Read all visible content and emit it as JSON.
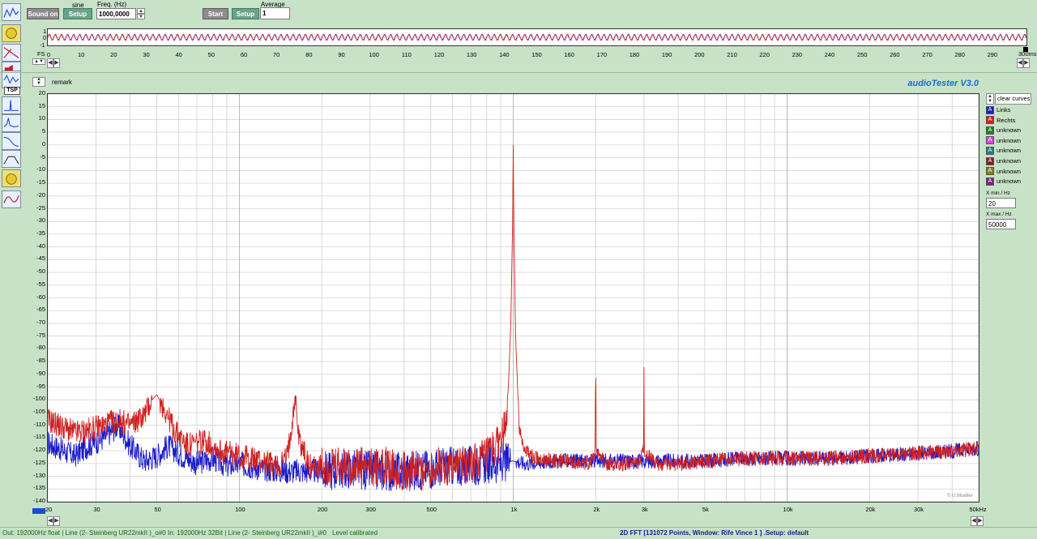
{
  "toolbar": {
    "waveform": "sine",
    "sound_on_label": "Sound on",
    "setup1_label": "Setup",
    "freq_label": "Freq. (Hz)",
    "freq_value": "1000,0000",
    "start_label": "Start",
    "setup2_label": "Setup",
    "average_label": "Average",
    "average_value": "1",
    "fs_label": "FS",
    "ms_unit": "300ms"
  },
  "time_plot": {
    "y_ticks": [
      "1",
      "0",
      "-1"
    ],
    "x_ticks": [
      "0",
      "10",
      "20",
      "30",
      "40",
      "50",
      "60",
      "70",
      "80",
      "90",
      "100",
      "110",
      "120",
      "130",
      "140",
      "150",
      "160",
      "170",
      "180",
      "190",
      "200",
      "210",
      "220",
      "230",
      "240",
      "250",
      "260",
      "270",
      "280",
      "290"
    ]
  },
  "main": {
    "remark": "remark",
    "app_title": "audioTester  V3.0",
    "copyright": "© U.Mueller",
    "clear_curves": "clear curves",
    "xmin_label": "X min / Hz",
    "xmin_value": "20",
    "xmax_label": "X max / Hz",
    "xmax_value": "50000",
    "tsp": "TSP"
  },
  "legend": [
    {
      "name": "Links",
      "color": "#1a1acc"
    },
    {
      "name": "Rechts",
      "color": "#d02020"
    },
    {
      "name": "unknown",
      "color": "#208020"
    },
    {
      "name": "unknown",
      "color": "#e040e0"
    },
    {
      "name": "unknown",
      "color": "#208080"
    },
    {
      "name": "unknown",
      "color": "#802020"
    },
    {
      "name": "unknown",
      "color": "#808020"
    },
    {
      "name": "unknown",
      "color": "#802080"
    }
  ],
  "status": {
    "out": "Out: 192000Hz float  | Line (2- Steinberg UR22mkII )_o#0  In: 192000Hz 32Bit  | Line (2- Steinberg UR22mkII )_i#0",
    "level": "Level calibrated",
    "fft": "2D FFT [131072 Points, Window: Rife Vince 1 ]  .Setup:  default"
  },
  "chart_data": {
    "type": "line",
    "xscale": "log",
    "xlim": [
      20,
      50000
    ],
    "ylim": [
      -140,
      20
    ],
    "y_ticks": [
      "20",
      "15",
      "10",
      "5",
      "0",
      "-5",
      "-10",
      "-15",
      "-20",
      "-25",
      "-30",
      "-35",
      "-40",
      "-45",
      "-50",
      "-55",
      "-60",
      "-65",
      "-70",
      "-75",
      "-80",
      "-85",
      "-90",
      "-95",
      "-100",
      "-105",
      "-110",
      "-115",
      "-120",
      "-125",
      "-130",
      "-135",
      "-140"
    ],
    "x_tick_labels": [
      {
        "v": 20,
        "t": "20"
      },
      {
        "v": 30,
        "t": "30"
      },
      {
        "v": 50,
        "t": "50"
      },
      {
        "v": 100,
        "t": "100"
      },
      {
        "v": 200,
        "t": "200"
      },
      {
        "v": 300,
        "t": "300"
      },
      {
        "v": 500,
        "t": "500"
      },
      {
        "v": 1000,
        "t": "1k"
      },
      {
        "v": 2000,
        "t": "2k"
      },
      {
        "v": 3000,
        "t": "3k"
      },
      {
        "v": 5000,
        "t": "5k"
      },
      {
        "v": 10000,
        "t": "10k"
      },
      {
        "v": 20000,
        "t": "20k"
      },
      {
        "v": 30000,
        "t": "30k"
      },
      {
        "v": 50000,
        "t": "50kHz"
      }
    ],
    "series": [
      {
        "name": "Rechts",
        "color": "#d02020",
        "points": [
          [
            20,
            -108
          ],
          [
            22,
            -110
          ],
          [
            25,
            -113
          ],
          [
            28,
            -112
          ],
          [
            32,
            -110
          ],
          [
            36,
            -108
          ],
          [
            40,
            -110
          ],
          [
            45,
            -106
          ],
          [
            48,
            -100
          ],
          [
            50,
            -98
          ],
          [
            53,
            -103
          ],
          [
            58,
            -112
          ],
          [
            65,
            -118
          ],
          [
            75,
            -116
          ],
          [
            85,
            -120
          ],
          [
            100,
            -122
          ],
          [
            120,
            -124
          ],
          [
            140,
            -126
          ],
          [
            150,
            -122
          ],
          [
            155,
            -110
          ],
          [
            160,
            -98
          ],
          [
            165,
            -115
          ],
          [
            180,
            -126
          ],
          [
            220,
            -127
          ],
          [
            260,
            -126
          ],
          [
            300,
            -127
          ],
          [
            350,
            -126
          ],
          [
            400,
            -128
          ],
          [
            450,
            -128
          ],
          [
            500,
            -127
          ],
          [
            550,
            -126
          ],
          [
            600,
            -126
          ],
          [
            700,
            -125
          ],
          [
            800,
            -123
          ],
          [
            880,
            -118
          ],
          [
            930,
            -112
          ],
          [
            960,
            -95
          ],
          [
            980,
            -70
          ],
          [
            995,
            -30
          ],
          [
            1000,
            0
          ],
          [
            1005,
            -30
          ],
          [
            1020,
            -75
          ],
          [
            1050,
            -110
          ],
          [
            1100,
            -120
          ],
          [
            1200,
            -123
          ],
          [
            1500,
            -124
          ],
          [
            1900,
            -125
          ],
          [
            1990,
            -120
          ],
          [
            2000,
            -82
          ],
          [
            2010,
            -120
          ],
          [
            2200,
            -125
          ],
          [
            2900,
            -125
          ],
          [
            2990,
            -120
          ],
          [
            3000,
            -87
          ],
          [
            3010,
            -120
          ],
          [
            3300,
            -125
          ],
          [
            4000,
            -125
          ],
          [
            5000,
            -124
          ],
          [
            7000,
            -123
          ],
          [
            10000,
            -123
          ],
          [
            15000,
            -123
          ],
          [
            20000,
            -122
          ],
          [
            30000,
            -121
          ],
          [
            40000,
            -120
          ],
          [
            50000,
            -119
          ]
        ]
      },
      {
        "name": "Links",
        "color": "#1a1acc",
        "points": [
          [
            20,
            -117
          ],
          [
            22,
            -119
          ],
          [
            25,
            -122
          ],
          [
            28,
            -118
          ],
          [
            32,
            -115
          ],
          [
            36,
            -110
          ],
          [
            40,
            -118
          ],
          [
            45,
            -124
          ],
          [
            50,
            -122
          ],
          [
            55,
            -118
          ],
          [
            60,
            -121
          ],
          [
            70,
            -125
          ],
          [
            80,
            -123
          ],
          [
            90,
            -126
          ],
          [
            100,
            -125
          ],
          [
            120,
            -127
          ],
          [
            150,
            -128
          ],
          [
            200,
            -128
          ],
          [
            250,
            -127
          ],
          [
            300,
            -128
          ],
          [
            400,
            -128
          ],
          [
            500,
            -127
          ],
          [
            600,
            -126
          ],
          [
            700,
            -126
          ],
          [
            800,
            -125
          ],
          [
            900,
            -125
          ],
          [
            1000,
            -124
          ],
          [
            1100,
            -125
          ],
          [
            1500,
            -124
          ],
          [
            2000,
            -124
          ],
          [
            3000,
            -124
          ],
          [
            5000,
            -124
          ],
          [
            7000,
            -123
          ],
          [
            10000,
            -123
          ],
          [
            15000,
            -123
          ],
          [
            20000,
            -122
          ],
          [
            30000,
            -121
          ],
          [
            40000,
            -120
          ],
          [
            50000,
            -119
          ]
        ]
      }
    ]
  }
}
